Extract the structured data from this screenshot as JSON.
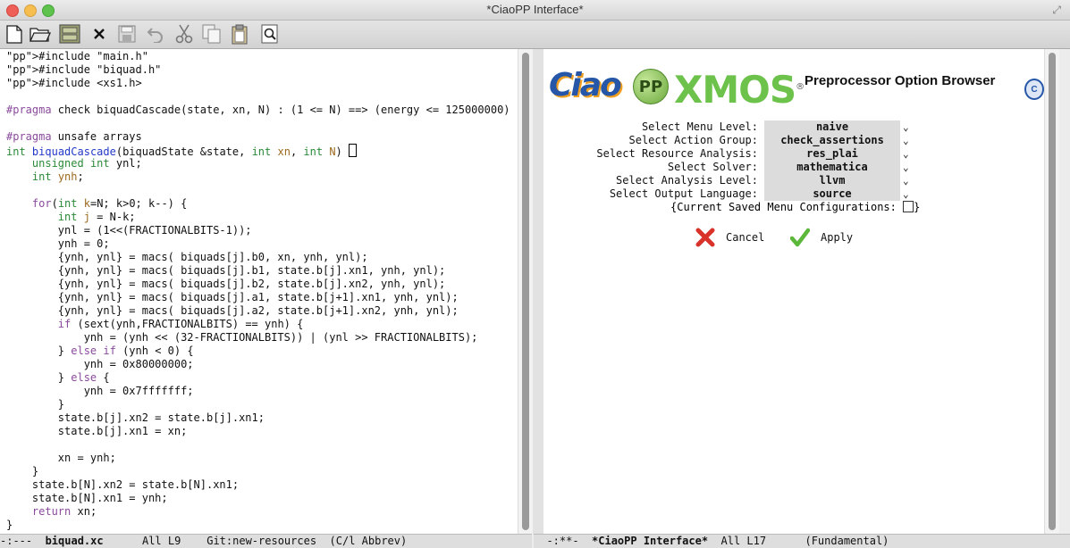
{
  "window": {
    "title": "*CiaoPP Interface*"
  },
  "toolbar": {
    "buttons": [
      {
        "name": "new-file-icon"
      },
      {
        "name": "open-folder-icon"
      },
      {
        "name": "save-cabinet-icon"
      },
      {
        "name": "close-x-icon"
      },
      {
        "name": "save-disk-icon"
      },
      {
        "name": "undo-icon"
      },
      {
        "name": "cut-icon"
      },
      {
        "name": "copy-icon"
      },
      {
        "name": "paste-icon"
      },
      {
        "name": "search-icon"
      }
    ]
  },
  "editor": {
    "lines": [
      "#include \"main.h\"",
      "#include \"biquad.h\"",
      "#include <xs1.h>",
      "",
      "#pragma check biquadCascade(state, xn, N) : (1 <= N) ==> (energy <= 125000000)",
      "",
      "#pragma unsafe arrays",
      "int biquadCascade(biquadState &state, int xn, int N) {",
      "    unsigned int ynl;",
      "    int ynh;",
      "",
      "    for(int k=N; k>0; k--) {",
      "        int j = N-k;",
      "        ynl = (1<<(FRACTIONALBITS-1));",
      "        ynh = 0;",
      "        {ynh, ynl} = macs( biquads[j].b0, xn, ynh, ynl);",
      "        {ynh, ynl} = macs( biquads[j].b1, state.b[j].xn1, ynh, ynl);",
      "        {ynh, ynl} = macs( biquads[j].b2, state.b[j].xn2, ynh, ynl);",
      "        {ynh, ynl} = macs( biquads[j].a1, state.b[j+1].xn1, ynh, ynl);",
      "        {ynh, ynl} = macs( biquads[j].a2, state.b[j+1].xn2, ynh, ynl);",
      "        if (sext(ynh,FRACTIONALBITS) == ynh) {",
      "            ynh = (ynh << (32-FRACTIONALBITS)) | (ynl >> FRACTIONALBITS);",
      "        } else if (ynh < 0) {",
      "            ynh = 0x80000000;",
      "        } else {",
      "            ynh = 0x7fffffff;",
      "        }",
      "        state.b[j].xn2 = state.b[j].xn1;",
      "        state.b[j].xn1 = xn;",
      "",
      "        xn = ynh;",
      "    }",
      "    state.b[N].xn2 = state.b[N].xn1;",
      "    state.b[N].xn1 = ynh;",
      "    return xn;",
      "}"
    ]
  },
  "panel": {
    "logo_ciao": "Ciao",
    "logo_pp": "PP",
    "logo_xmos": "XMOS",
    "logo_reg": "®",
    "heading": "Preprocessor Option Browser",
    "options": [
      {
        "label": "Select Menu Level:",
        "value": "naive"
      },
      {
        "label": "Select Action Group:",
        "value": "check_assertions"
      },
      {
        "label": "Select Resource Analysis:",
        "value": "res_plai"
      },
      {
        "label": "Select Solver:",
        "value": "mathematica"
      },
      {
        "label": "Select Analysis Level:",
        "value": "llvm"
      },
      {
        "label": "Select Output Language:",
        "value": "source"
      }
    ],
    "saved_configs_label": "{Current Saved Menu Configurations:",
    "saved_configs_close": "}",
    "cancel_label": "Cancel",
    "apply_label": "Apply"
  },
  "modeline_left": {
    "status": "-:---",
    "buffer": "biquad.xc",
    "position": "All L9",
    "vc": "Git:new-resources",
    "mode": "(C/l Abbrev)"
  },
  "modeline_right": {
    "status": "-:**-",
    "buffer": "*CiaoPP Interface*",
    "position": "All L17",
    "mode": "(Fundamental)"
  }
}
